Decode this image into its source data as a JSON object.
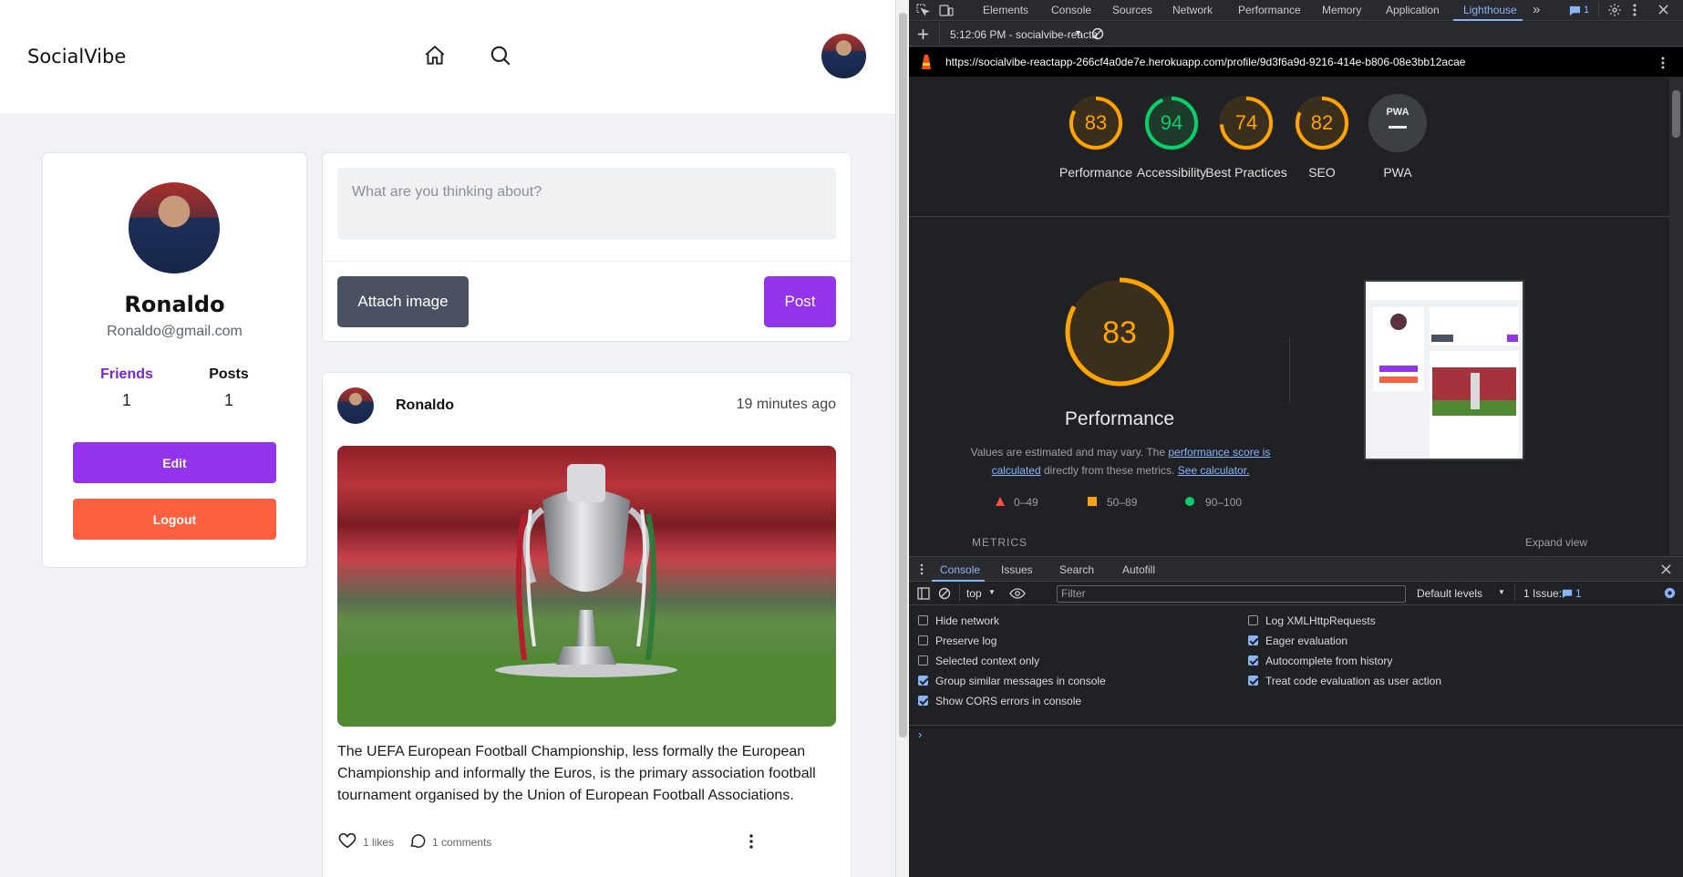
{
  "page": {
    "brand": "SocialVibe",
    "profile": {
      "name": "Ronaldo",
      "email": "Ronaldo@gmail.com",
      "friends_label": "Friends",
      "friends_count": "1",
      "posts_label": "Posts",
      "posts_count": "1",
      "edit_label": "Edit",
      "logout_label": "Logout"
    },
    "composer": {
      "placeholder": "What are you thinking about?",
      "attach_label": "Attach image",
      "post_label": "Post"
    },
    "post": {
      "author": "Ronaldo",
      "time": "19 minutes ago",
      "text": "The UEFA European Football Championship, less formally the European Championship and informally the Euros, is the primary association football tournament organised by the Union of European Football Associations.",
      "likes": "1 likes",
      "comments": "1 comments"
    }
  },
  "devtools": {
    "tabs": [
      "Elements",
      "Console",
      "Sources",
      "Network",
      "Performance",
      "Memory",
      "Application",
      "Lighthouse"
    ],
    "active_tab": "Lighthouse",
    "issues_badge": "1",
    "report_selector": "5:12:06 PM - socialvibe-reacta",
    "url": "https://socialvibe-reactapp-266cf4a0de7e.herokuapp.com/profile/9d3f6a9d-9216-414e-b806-08e3bb12acae",
    "scores": [
      {
        "label": "Performance",
        "value": "83",
        "score": 83,
        "color": "#ffa400"
      },
      {
        "label": "Accessibility",
        "value": "94",
        "score": 94,
        "color": "#0cce6b"
      },
      {
        "label": "Best Practices",
        "value": "74",
        "score": 74,
        "color": "#ffa400"
      },
      {
        "label": "SEO",
        "value": "82",
        "score": 82,
        "color": "#ffa400"
      },
      {
        "label": "PWA",
        "value": "PWA",
        "score": 0,
        "color": "#9aa0a6"
      }
    ],
    "big": {
      "value": "83",
      "score": 83,
      "label": "Performance",
      "note_pre": "Values are estimated and may vary. The ",
      "note_link1": "performance score is calculated",
      "note_mid": " directly from these metrics. ",
      "note_link2": "See calculator."
    },
    "legend": {
      "red": "0–49",
      "orange": "50–89",
      "green": "90–100"
    },
    "metrics_label": "METRICS",
    "expand_label": "Expand view",
    "console_tabs": [
      "Console",
      "Issues",
      "Search",
      "Autofill"
    ],
    "context": "top",
    "filter_placeholder": "Filter",
    "levels": "Default levels",
    "issues_text": "1 Issue:",
    "issues_count": "1",
    "options_left": [
      {
        "label": "Hide network",
        "checked": false
      },
      {
        "label": "Preserve log",
        "checked": false
      },
      {
        "label": "Selected context only",
        "checked": false
      },
      {
        "label": "Group similar messages in console",
        "checked": true
      },
      {
        "label": "Show CORS errors in console",
        "checked": true
      }
    ],
    "options_right": [
      {
        "label": "Log XMLHttpRequests",
        "checked": false
      },
      {
        "label": "Eager evaluation",
        "checked": true
      },
      {
        "label": "Autocomplete from history",
        "checked": true
      },
      {
        "label": "Treat code evaluation as user action",
        "checked": true
      }
    ]
  }
}
